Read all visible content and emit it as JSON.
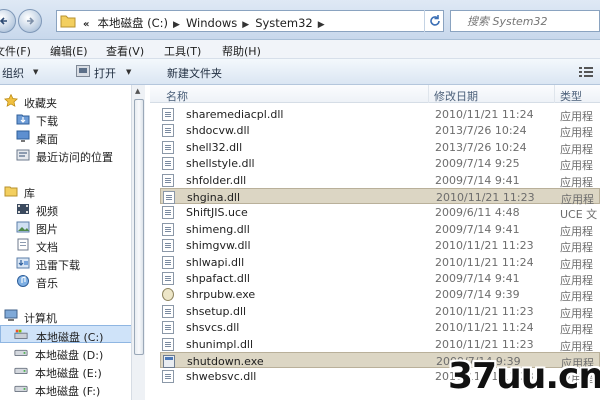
{
  "address": {
    "lead": "«",
    "crumbs": [
      "本地磁盘 (C:)",
      "Windows",
      "System32"
    ],
    "separator": "▶",
    "dropdown_arrow": "▼"
  },
  "search": {
    "placeholder": "搜索 System32"
  },
  "menu": [
    "文件(F)",
    "编辑(E)",
    "查看(V)",
    "工具(T)",
    "帮助(H)"
  ],
  "toolbar": {
    "organize": "组织",
    "open": "打开",
    "new_folder": "新建文件夹",
    "caret": "▼"
  },
  "nav": {
    "favorites": {
      "label": "收藏夹",
      "items": [
        "下载",
        "桌面",
        "最近访问的位置"
      ]
    },
    "libraries": {
      "label": "库",
      "items": [
        "视频",
        "图片",
        "文档",
        "迅雷下载",
        "音乐"
      ]
    },
    "computer": {
      "label": "计算机",
      "drives": [
        "本地磁盘 (C:)",
        "本地磁盘 (D:)",
        "本地磁盘 (E:)",
        "本地磁盘 (F:)"
      ],
      "selected_drive": 0
    }
  },
  "columns": {
    "name": "名称",
    "modified": "修改日期",
    "type": "类型"
  },
  "files": [
    {
      "name": "sharemediacpl.dll",
      "date": "2010/11/21 11:24",
      "type": "应用程",
      "icon": "dll-icon"
    },
    {
      "name": "shdocvw.dll",
      "date": "2013/7/26 10:24",
      "type": "应用程",
      "icon": "dll-icon"
    },
    {
      "name": "shell32.dll",
      "date": "2013/7/26 10:24",
      "type": "应用程",
      "icon": "dll-icon"
    },
    {
      "name": "shellstyle.dll",
      "date": "2009/7/14 9:25",
      "type": "应用程",
      "icon": "dll-icon"
    },
    {
      "name": "shfolder.dll",
      "date": "2009/7/14 9:41",
      "type": "应用程",
      "icon": "dll-icon"
    },
    {
      "name": "shgina.dll",
      "date": "2010/11/21 11:23",
      "type": "应用程",
      "icon": "dll-icon",
      "selected": true
    },
    {
      "name": "ShiftJIS.uce",
      "date": "2009/6/11 4:48",
      "type": "UCE 文",
      "icon": "file-icon"
    },
    {
      "name": "shimeng.dll",
      "date": "2009/7/14 9:41",
      "type": "应用程",
      "icon": "dll-icon"
    },
    {
      "name": "shimgvw.dll",
      "date": "2010/11/21 11:23",
      "type": "应用程",
      "icon": "dll-icon"
    },
    {
      "name": "shlwapi.dll",
      "date": "2010/11/21 11:24",
      "type": "应用程",
      "icon": "dll-icon"
    },
    {
      "name": "shpafact.dll",
      "date": "2009/7/14 9:41",
      "type": "应用程",
      "icon": "dll-icon"
    },
    {
      "name": "shrpubw.exe",
      "date": "2009/7/14 9:39",
      "type": "应用程",
      "icon": "exe-gear-icon"
    },
    {
      "name": "shsetup.dll",
      "date": "2010/11/21 11:23",
      "type": "应用程",
      "icon": "dll-icon"
    },
    {
      "name": "shsvcs.dll",
      "date": "2010/11/21 11:24",
      "type": "应用程",
      "icon": "dll-icon"
    },
    {
      "name": "shunimpl.dll",
      "date": "2010/11/21 11:23",
      "type": "应用程",
      "icon": "dll-icon"
    },
    {
      "name": "shutdown.exe",
      "date": "2009/7/14 9:39",
      "type": "应用程",
      "icon": "exe-icon",
      "selected": true
    },
    {
      "name": "shwebsvc.dll",
      "date": "2010/11/21 11:23",
      "type": "应用程",
      "icon": "dll-icon"
    }
  ],
  "watermark": "37uu.cn",
  "colors": {
    "selection": "#dcd6c4",
    "nav_selection": "#cfe3f9",
    "address_bar": "#c8d8ec"
  }
}
